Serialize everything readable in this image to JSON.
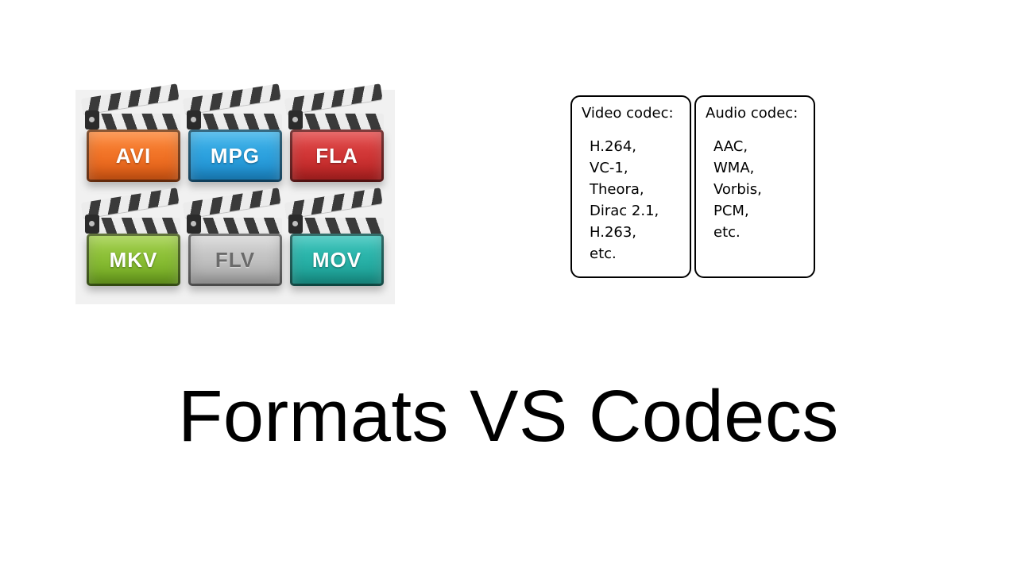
{
  "headline": "Formats VS Codecs",
  "formats": [
    {
      "label": "AVI",
      "color": "c-orange"
    },
    {
      "label": "MPG",
      "color": "c-blue"
    },
    {
      "label": "FLA",
      "color": "c-red"
    },
    {
      "label": "MKV",
      "color": "c-green"
    },
    {
      "label": "FLV",
      "color": "c-gray"
    },
    {
      "label": "MOV",
      "color": "c-teal"
    }
  ],
  "codecs": {
    "video": {
      "title": "Video codec:",
      "items": "H.264,\nVC-1,\nTheora,\nDirac 2.1,\nH.263,\netc."
    },
    "audio": {
      "title": "Audio codec:",
      "items": "AAC,\nWMA,\nVorbis,\nPCM,\netc."
    }
  }
}
